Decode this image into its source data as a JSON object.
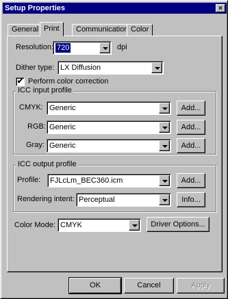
{
  "dialog": {
    "title": "Setup Properties",
    "close_glyph": "×"
  },
  "tabs": [
    {
      "label": "General"
    },
    {
      "label": "Print"
    },
    {
      "label": "Communication"
    },
    {
      "label": "Color"
    }
  ],
  "resolution": {
    "label": "Resolution:",
    "value": "720",
    "unit": "dpi"
  },
  "dither": {
    "label": "Dither type:",
    "value": "LX Diffusion"
  },
  "color_correction": {
    "label": "Perform color correction",
    "checked": true,
    "check_glyph": "✔"
  },
  "icc_input": {
    "title": "ICC input profile",
    "rows": [
      {
        "label": "CMYK:",
        "value": "Generic",
        "button": "Add..."
      },
      {
        "label": "RGB:",
        "value": "Generic",
        "button": "Add..."
      },
      {
        "label": "Gray:",
        "value": "Generic",
        "button": "Add..."
      }
    ]
  },
  "icc_output": {
    "title": "ICC output profile",
    "profile": {
      "label": "Profile:",
      "value": "FJLcLm_BEC360.icm",
      "button": "Add..."
    },
    "intent": {
      "label": "Rendering intent:",
      "value": "Perceptual",
      "button": "Info..."
    }
  },
  "color_mode": {
    "label": "Color Mode:",
    "value": "CMYK",
    "button": "Driver Options..."
  },
  "footer": {
    "ok": "OK",
    "cancel": "Cancel",
    "apply": "Apply"
  },
  "colors": {
    "title_bar": "#000080",
    "face": "#c0c0c0",
    "highlight": "#000080"
  }
}
